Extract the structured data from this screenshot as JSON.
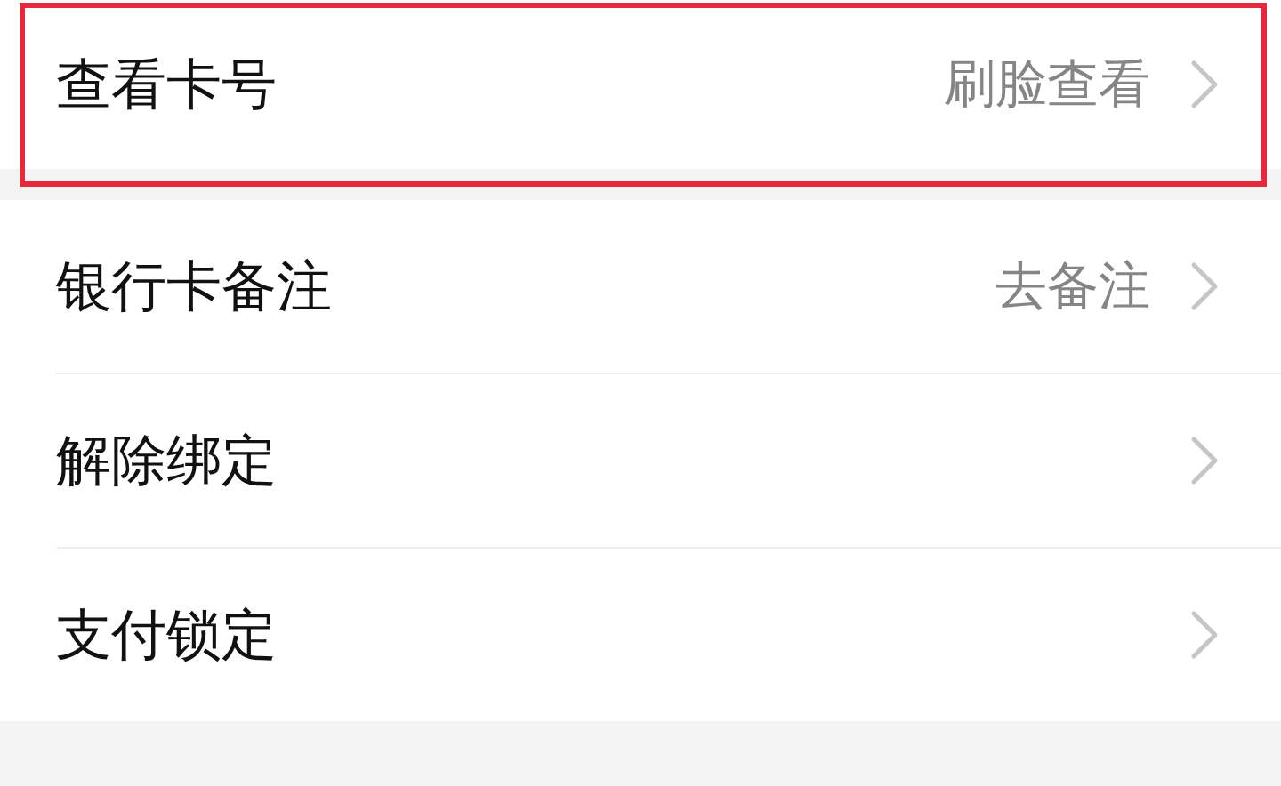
{
  "groups": [
    {
      "rows": [
        {
          "label": "查看卡号",
          "value": "刷脸查看",
          "highlighted": true
        }
      ]
    },
    {
      "rows": [
        {
          "label": "银行卡备注",
          "value": "去备注",
          "highlighted": false
        },
        {
          "label": "解除绑定",
          "highlighted": false
        },
        {
          "label": "支付锁定",
          "highlighted": false
        }
      ]
    }
  ]
}
